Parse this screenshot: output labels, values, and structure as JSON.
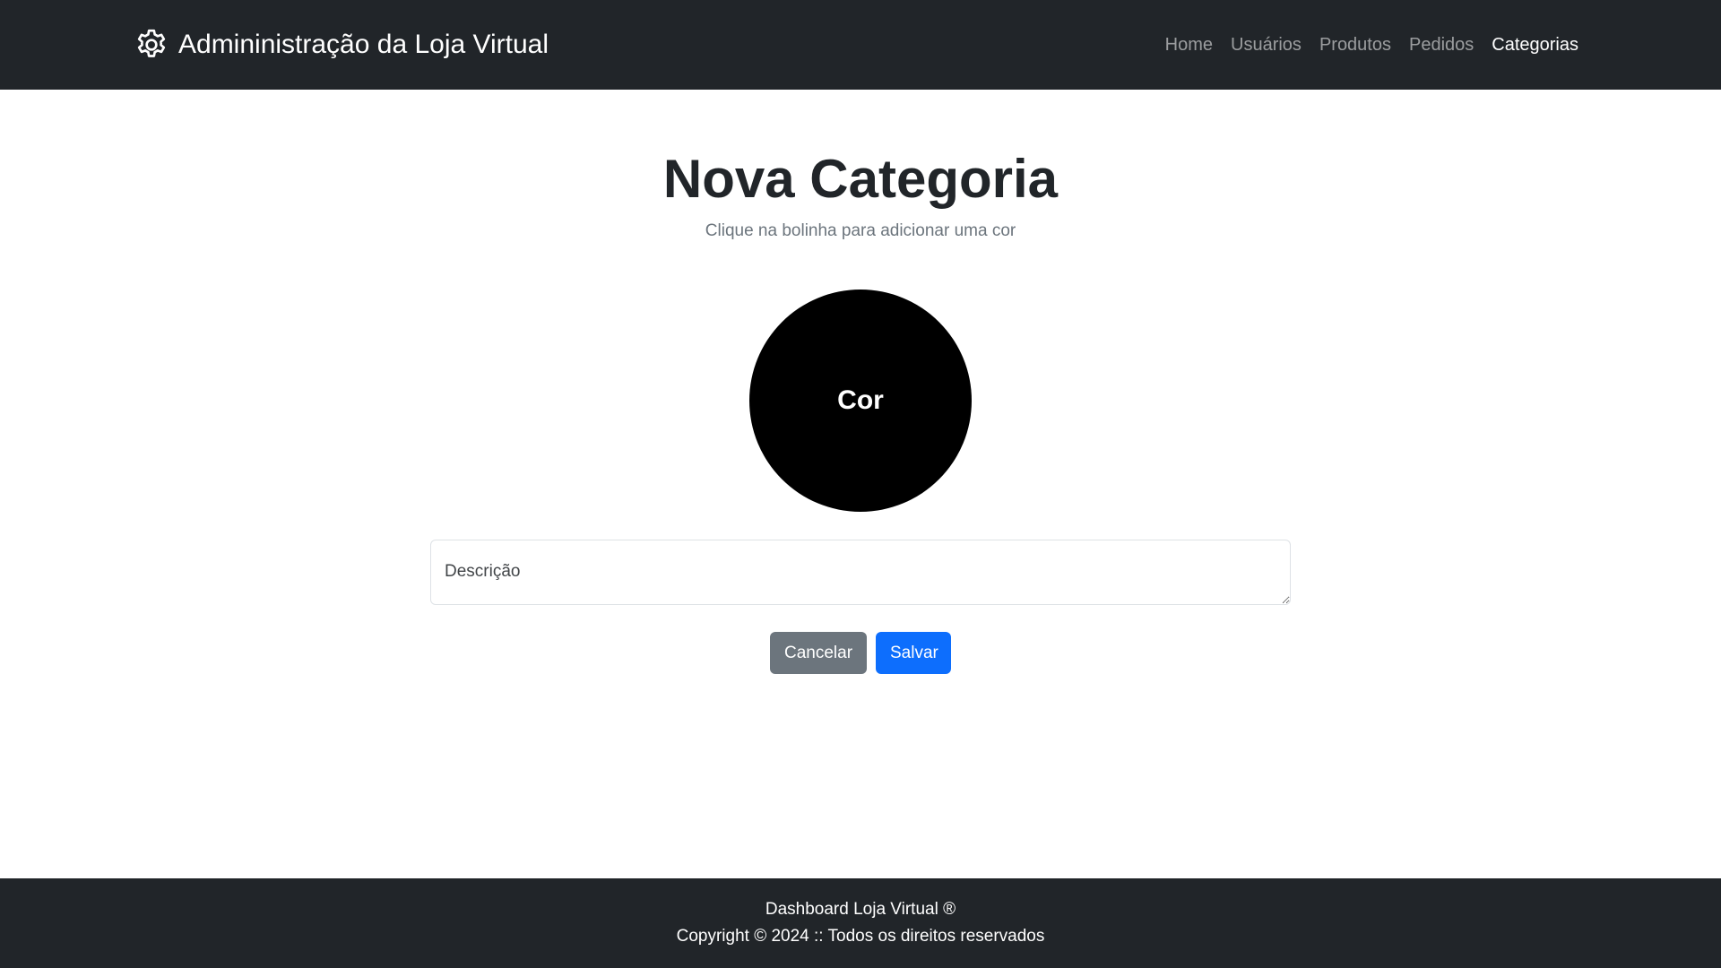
{
  "navbar": {
    "brand_title": "Admininistração da Loja Virtual",
    "brand_icon": "gear-icon",
    "links": [
      {
        "label": "Home",
        "active": false
      },
      {
        "label": "Usuários",
        "active": false
      },
      {
        "label": "Produtos",
        "active": false
      },
      {
        "label": "Pedidos",
        "active": false
      },
      {
        "label": "Categorias",
        "active": true
      }
    ]
  },
  "main": {
    "title": "Nova Categoria",
    "subtitle": "Clique na bolinha para adicionar uma cor",
    "color_picker": {
      "label": "Cor",
      "current_color": "#000000"
    },
    "description": {
      "placeholder": "Descrição",
      "value": ""
    },
    "buttons": {
      "cancel_label": "Cancelar",
      "save_label": "Salvar"
    }
  },
  "footer": {
    "line1": "Dashboard Loja Virtual ®",
    "line2": "Copyright © 2024 :: Todos os direitos reservados"
  },
  "colors": {
    "navbar_bg": "#212529",
    "primary": "#0d6efd",
    "secondary": "#6c757d"
  }
}
